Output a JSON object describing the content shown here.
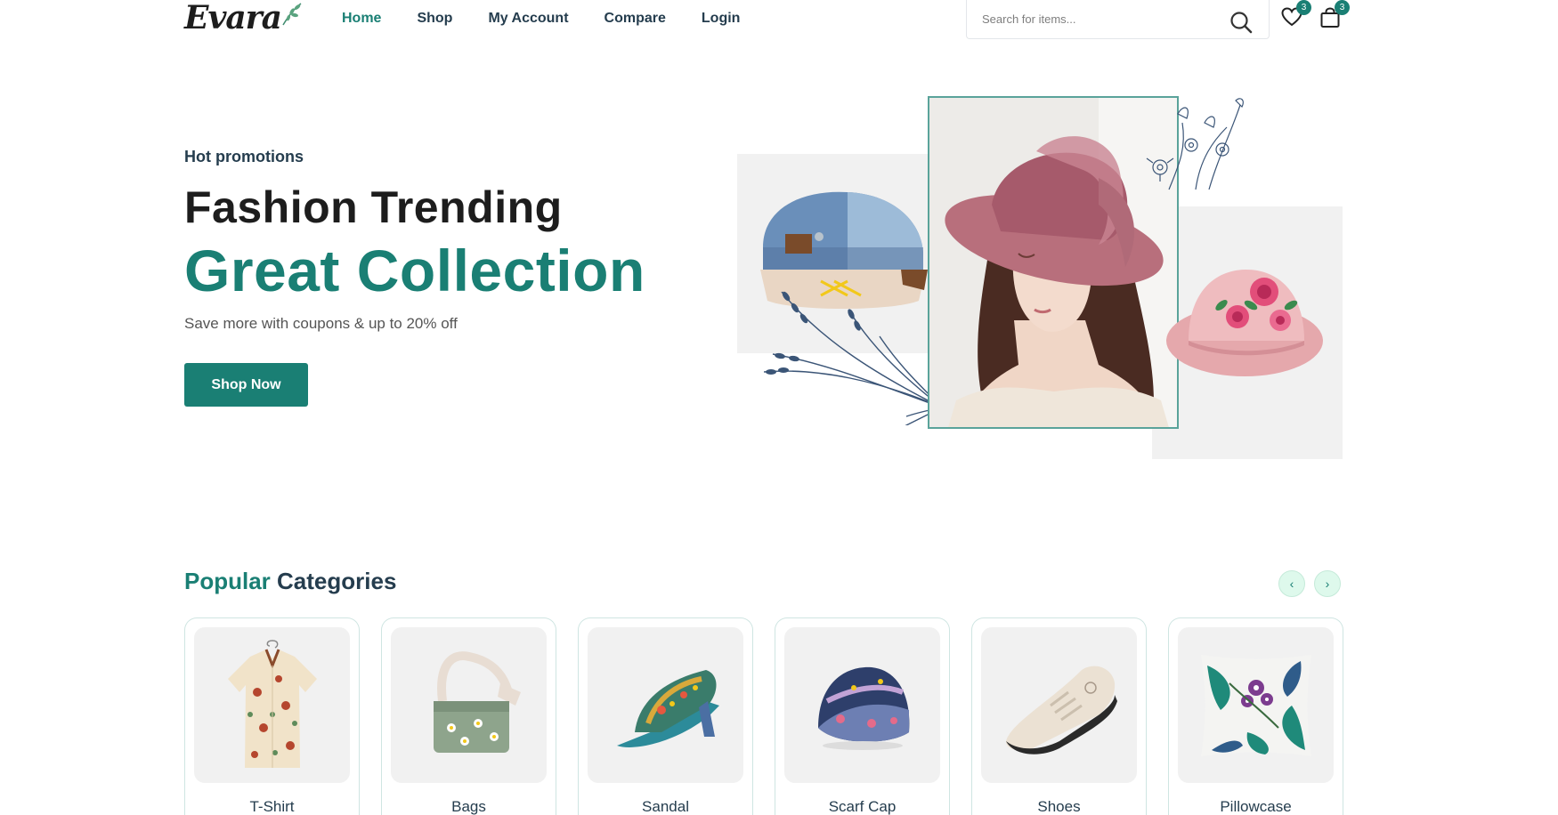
{
  "header": {
    "logo": "Evara",
    "nav": [
      {
        "label": "Home",
        "active": true
      },
      {
        "label": "Shop",
        "active": false
      },
      {
        "label": "My Account",
        "active": false
      },
      {
        "label": "Compare",
        "active": false
      },
      {
        "label": "Login",
        "active": false
      }
    ],
    "search_placeholder": "Search for items...",
    "wishlist_count": "3",
    "cart_count": "3"
  },
  "hero": {
    "subtitle": "Hot promotions",
    "title_line1": "Fashion Trending",
    "title_line2": "Great Collection",
    "description": "Save more with coupons & up to 20% off",
    "button": "Shop Now"
  },
  "categories": {
    "title_accent": "Popular",
    "title_rest": "Categories",
    "items": [
      {
        "label": "T-Shirt"
      },
      {
        "label": "Bags"
      },
      {
        "label": "Sandal"
      },
      {
        "label": "Scarf Cap"
      },
      {
        "label": "Shoes"
      },
      {
        "label": "Pillowcase"
      }
    ]
  },
  "colors": {
    "brand": "#1a7f74",
    "text": "#253D4E"
  }
}
